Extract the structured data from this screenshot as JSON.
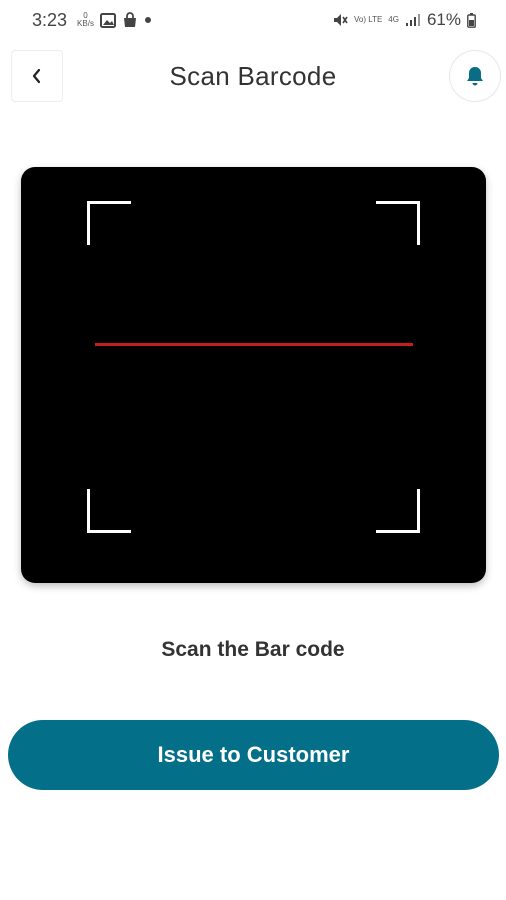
{
  "status_bar": {
    "time": "3:23",
    "data_speed": "0\nKB/s",
    "battery": "61%",
    "network_label_1": "Vo) LTE",
    "network_label_2": "4G",
    "icons": [
      "data-speed-icon",
      "gallery-icon",
      "bag-icon",
      "dot-icon",
      "mute-icon",
      "signal-icon",
      "battery-icon"
    ]
  },
  "header": {
    "title": "Scan Barcode",
    "back_icon": "chevron-left-icon",
    "notification_icon": "bell-icon"
  },
  "scanner": {
    "scan_line_color": "#c41f1f",
    "frame_color": "#ffffff",
    "background": "#000000"
  },
  "instruction": "Scan the Bar code",
  "action_button": {
    "label": "Issue to Customer",
    "color": "#036f88"
  }
}
